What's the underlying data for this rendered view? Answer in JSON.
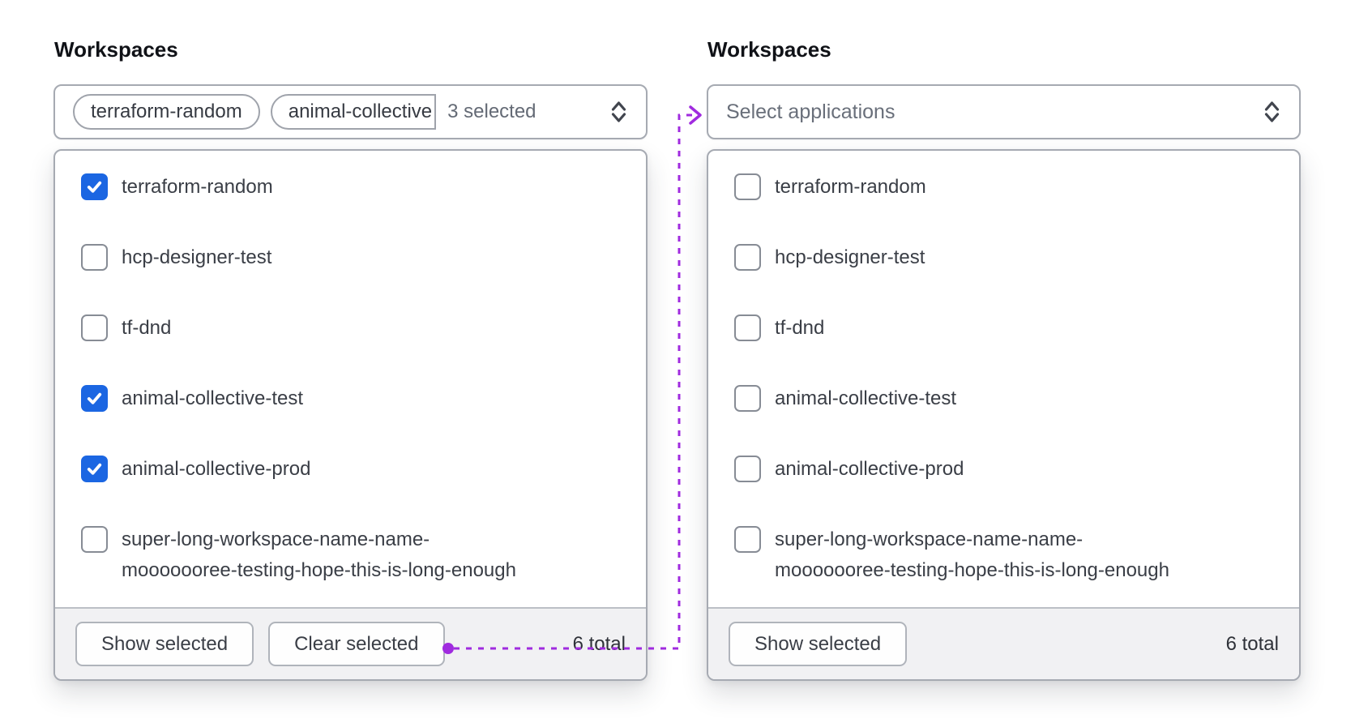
{
  "colors": {
    "checkbox_checked": "#1b66e2",
    "arrow_purple": "#a02bdf"
  },
  "annotation_arrow": {
    "style": "dotted",
    "from": "clear-selected-button",
    "to": "applications-select-toggle",
    "color": "#a02bdf"
  },
  "left_panel": {
    "label": "Workspaces",
    "toggle": {
      "tags": [
        "terraform-random",
        "animal-collective"
      ],
      "count_text": "3 selected"
    },
    "options": [
      {
        "label": "terraform-random",
        "checked": true
      },
      {
        "label": "hcp-designer-test",
        "checked": false
      },
      {
        "label": "tf-dnd",
        "checked": false
      },
      {
        "label": "animal-collective-test",
        "checked": true
      },
      {
        "label": "animal-collective-prod",
        "checked": true
      },
      {
        "label": "super-long-workspace-name-name-mooooooree-testing-hope-this-is-long-enough",
        "checked": false
      }
    ],
    "footer": {
      "show_selected": "Show selected",
      "clear_selected": "Clear selected",
      "total": "6 total"
    }
  },
  "right_panel": {
    "label": "Workspaces",
    "toggle": {
      "placeholder": "Select applications"
    },
    "options": [
      {
        "label": "terraform-random",
        "checked": false
      },
      {
        "label": "hcp-designer-test",
        "checked": false
      },
      {
        "label": "tf-dnd",
        "checked": false
      },
      {
        "label": "animal-collective-test",
        "checked": false
      },
      {
        "label": "animal-collective-prod",
        "checked": false
      },
      {
        "label": "super-long-workspace-name-name-mooooooree-testing-hope-this-is-long-enough",
        "checked": false
      }
    ],
    "footer": {
      "show_selected": "Show selected",
      "total": "6 total"
    }
  }
}
